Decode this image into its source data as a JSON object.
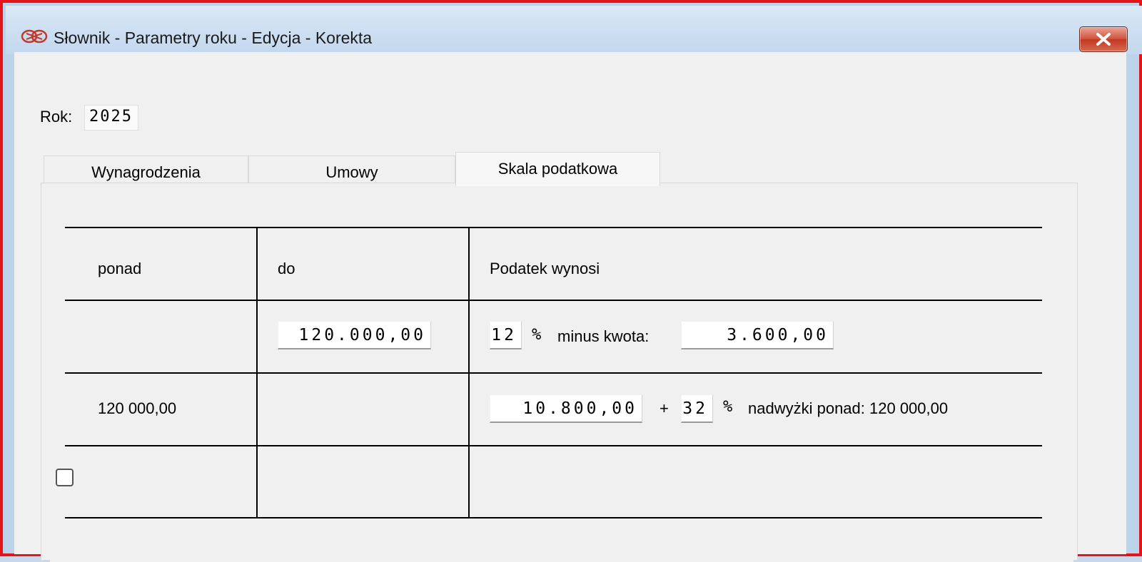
{
  "window": {
    "title": "Słownik - Parametry roku - Edycja - Korekta",
    "app_icon": "linked-rings-icon",
    "close_icon": "close-x-icon"
  },
  "year": {
    "label": "Rok:",
    "value": "2025"
  },
  "tabs": [
    {
      "label": "Wynagrodzenia",
      "active": false
    },
    {
      "label": "Umowy",
      "active": false
    },
    {
      "label": "Skala podatkowa",
      "active": true
    }
  ],
  "tax_table": {
    "headers": {
      "over": "ponad",
      "to": "do",
      "tax": "Podatek wynosi"
    },
    "row1": {
      "over": "",
      "to": "120.000,00",
      "rate": "12",
      "percent_sign": "%",
      "minus_label": "minus kwota:",
      "minus_amount": "3.600,00"
    },
    "row2": {
      "over": "120 000,00",
      "base_amount": "10.800,00",
      "plus_sign": "+",
      "rate": "32",
      "percent_sign": "%",
      "excess_label": "nadwyżki ponad: 120 000,00"
    },
    "row3": {
      "checkbox_checked": false
    }
  },
  "colors": {
    "window_border": "#e3151b",
    "close_button": "#c2381f",
    "client_bg": "#f0f0f0"
  }
}
